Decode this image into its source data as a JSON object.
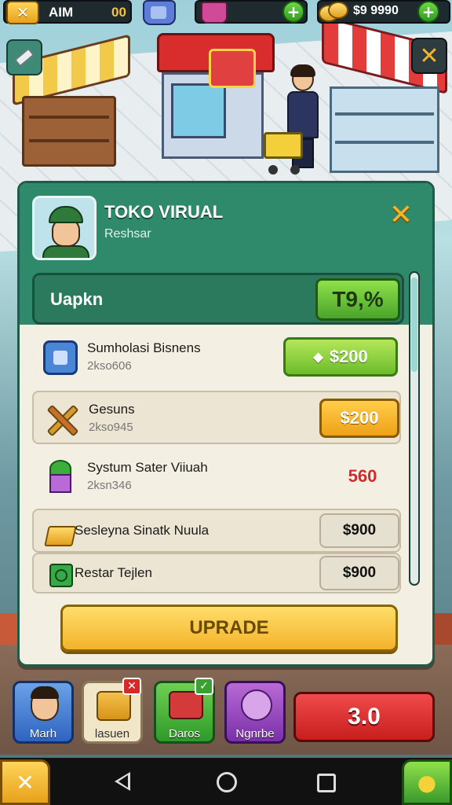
{
  "topbar": {
    "player_label": "AIM",
    "player_value": "00",
    "money": "$9 9990"
  },
  "panel": {
    "title": "TOKO VIRUAL",
    "subtitle": "Reshsar",
    "progress_label": "Uapkn",
    "progress_value": "T9,%",
    "items": [
      {
        "title": "Sumholasi Bisnens",
        "sub": "2kso606",
        "price": "$200",
        "icon": "blue-box-icon"
      },
      {
        "title": "Gesuns",
        "sub": "2kso945",
        "price": "$200",
        "icon": "crossed-tools-icon"
      },
      {
        "title": "Systum Sater Viiuah",
        "sub": "2ksn346",
        "price": "560",
        "icon": "potted-plant-icon"
      },
      {
        "title": "Sesleyna Sinatk Nuula",
        "price": "$900",
        "icon": "gold-bar-icon"
      },
      {
        "title": "Restar Tejlen",
        "price": "$900",
        "icon": "green-square-icon"
      }
    ],
    "upgrade_label": "UPRADE"
  },
  "toolbar": {
    "items": [
      {
        "label": "Marh"
      },
      {
        "label": "lasuen"
      },
      {
        "label": "Daros"
      },
      {
        "label": "Ngnrbe"
      }
    ],
    "action_value": "3.0"
  },
  "colors": {
    "panel_header": "#2f8a6b",
    "accent_green": "#6cbc2a",
    "accent_orange": "#f0a018",
    "accent_red": "#c81e1e",
    "upgrade_yellow": "#f3b22a"
  }
}
